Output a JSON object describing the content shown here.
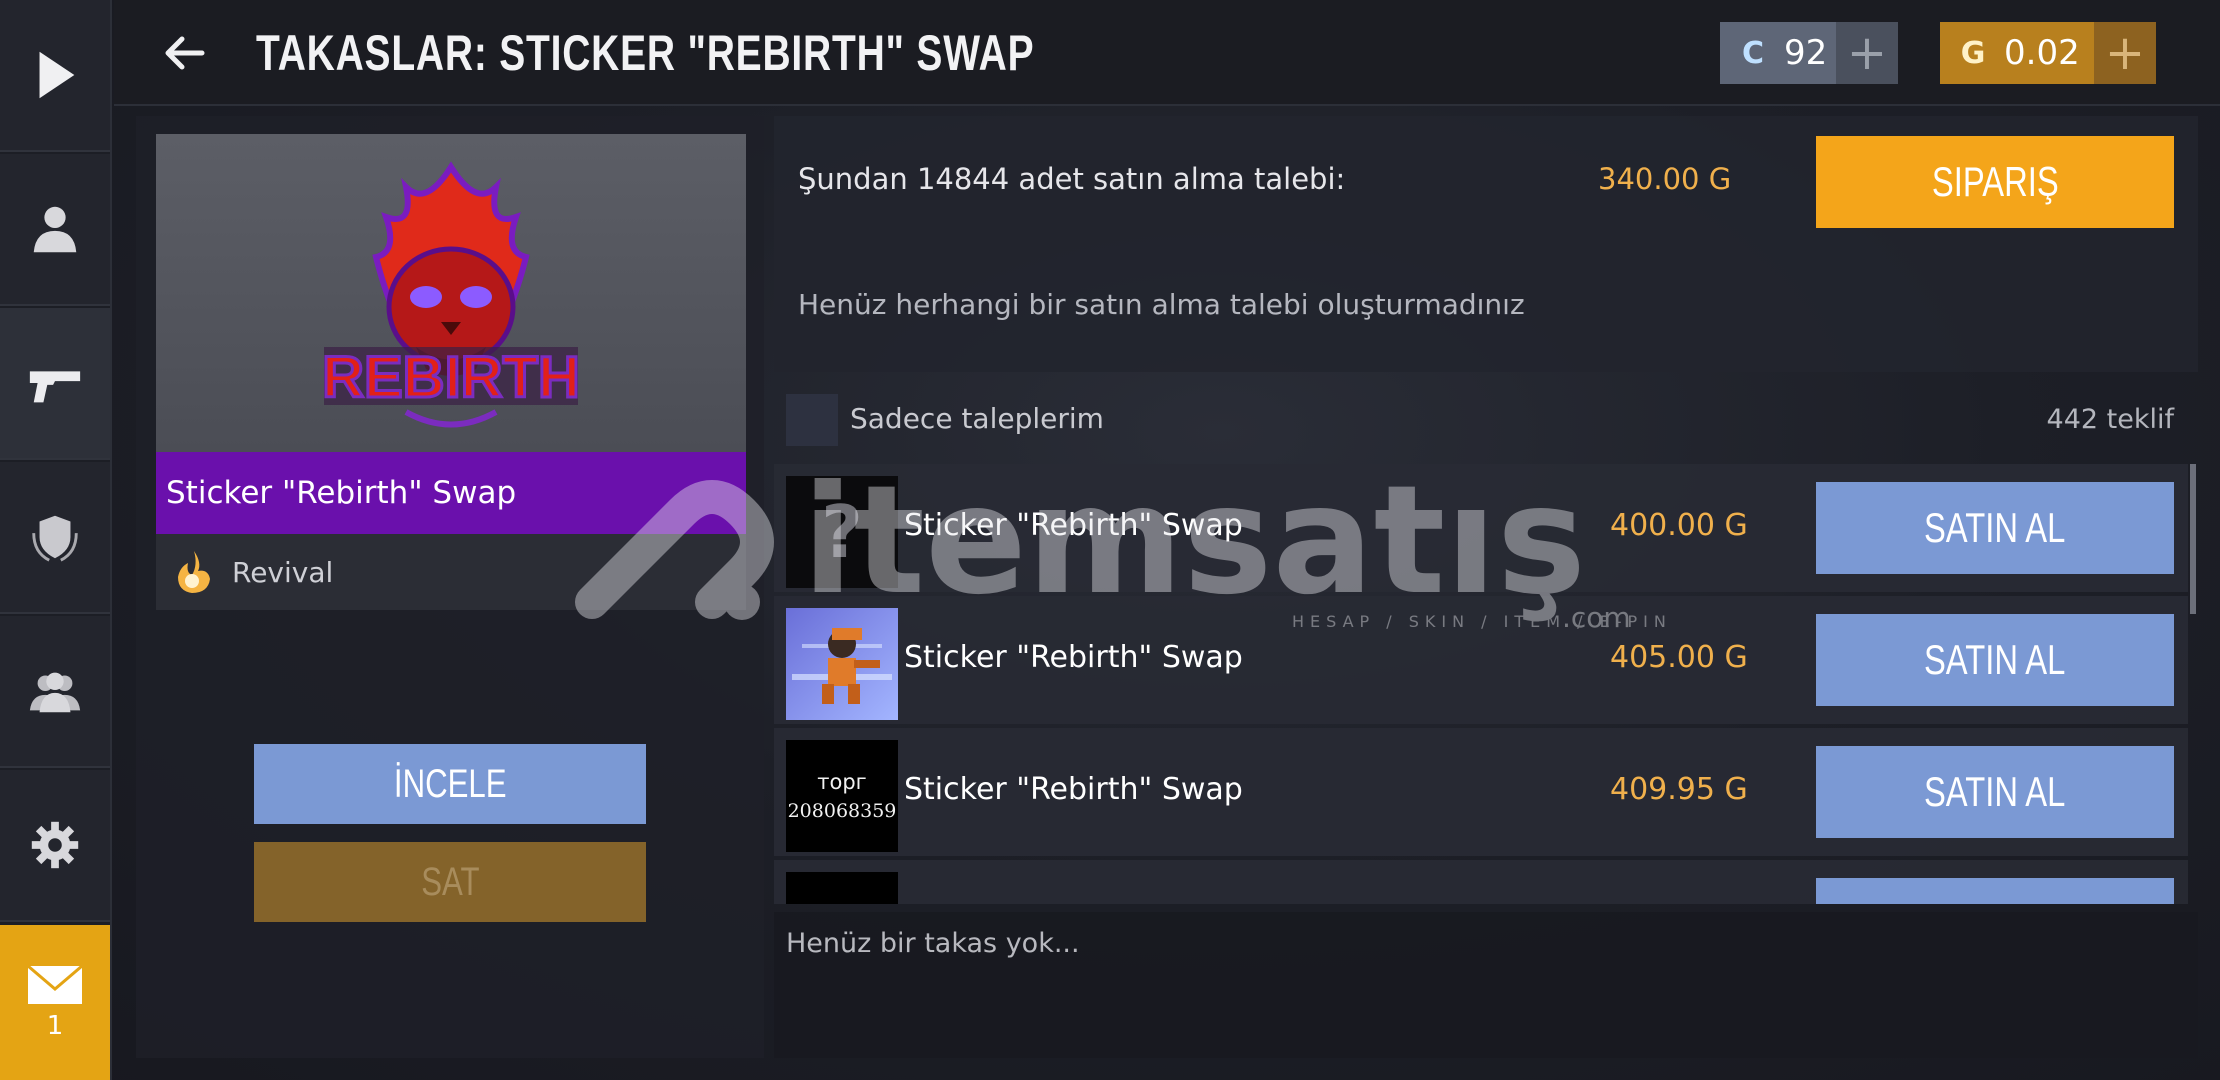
{
  "header": {
    "title": "TAKASLAR: STICKER \"REBIRTH\" SWAP",
    "currency_c": {
      "symbol": "C",
      "value": "92",
      "add": "+"
    },
    "currency_g": {
      "symbol": "G",
      "value": "0.02",
      "add": "+"
    }
  },
  "sidebar": {
    "items": [
      {
        "icon": "play-icon"
      },
      {
        "icon": "profile-icon"
      },
      {
        "icon": "pistol-icon"
      },
      {
        "icon": "shield-laurel-icon"
      },
      {
        "icon": "friends-icon"
      },
      {
        "icon": "gear-icon"
      }
    ],
    "mail": {
      "icon": "mail-icon",
      "count": "1"
    }
  },
  "item": {
    "logo_text": "REBIRTH",
    "name": "Sticker \"Rebirth\" Swap",
    "collection": "Revival",
    "inspect_label": "İNCELE",
    "sell_label": "SAT"
  },
  "buy_request": {
    "text": "Şundan 14844 adet satın alma talebi:",
    "price": "340.00 G",
    "order_label": "SIPARIŞ",
    "no_requests": "Henüz herhangi bir satın alma talebi oluşturmadınız"
  },
  "filter": {
    "label": "Sadece taleplerim",
    "offer_count": "442 teklif"
  },
  "offers": [
    {
      "thumb_text": "?",
      "thumb_text2": "",
      "name": "Sticker \"Rebirth\" Swap",
      "price": "400.00 G",
      "buy_label": "SATIN AL"
    },
    {
      "thumb_text": "",
      "thumb_text2": "",
      "name": "Sticker \"Rebirth\" Swap",
      "price": "405.00 G",
      "buy_label": "SATIN AL"
    },
    {
      "thumb_text": "торг",
      "thumb_text2": "208068359",
      "name": "Sticker \"Rebirth\" Swap",
      "price": "409.95 G",
      "buy_label": "SATIN AL"
    }
  ],
  "trades_empty": "Henüz bir takas yok...",
  "watermark": {
    "brand": "itemsatış",
    "tagline": "HESAP / SKIN / ITEM / E-PIN",
    "suffix": ".com"
  },
  "colors": {
    "accent_orange": "#f4a51a",
    "buy_blue": "#7b99d4",
    "rarity_purple": "#6a10ac",
    "price_gold": "#f0b04c"
  }
}
